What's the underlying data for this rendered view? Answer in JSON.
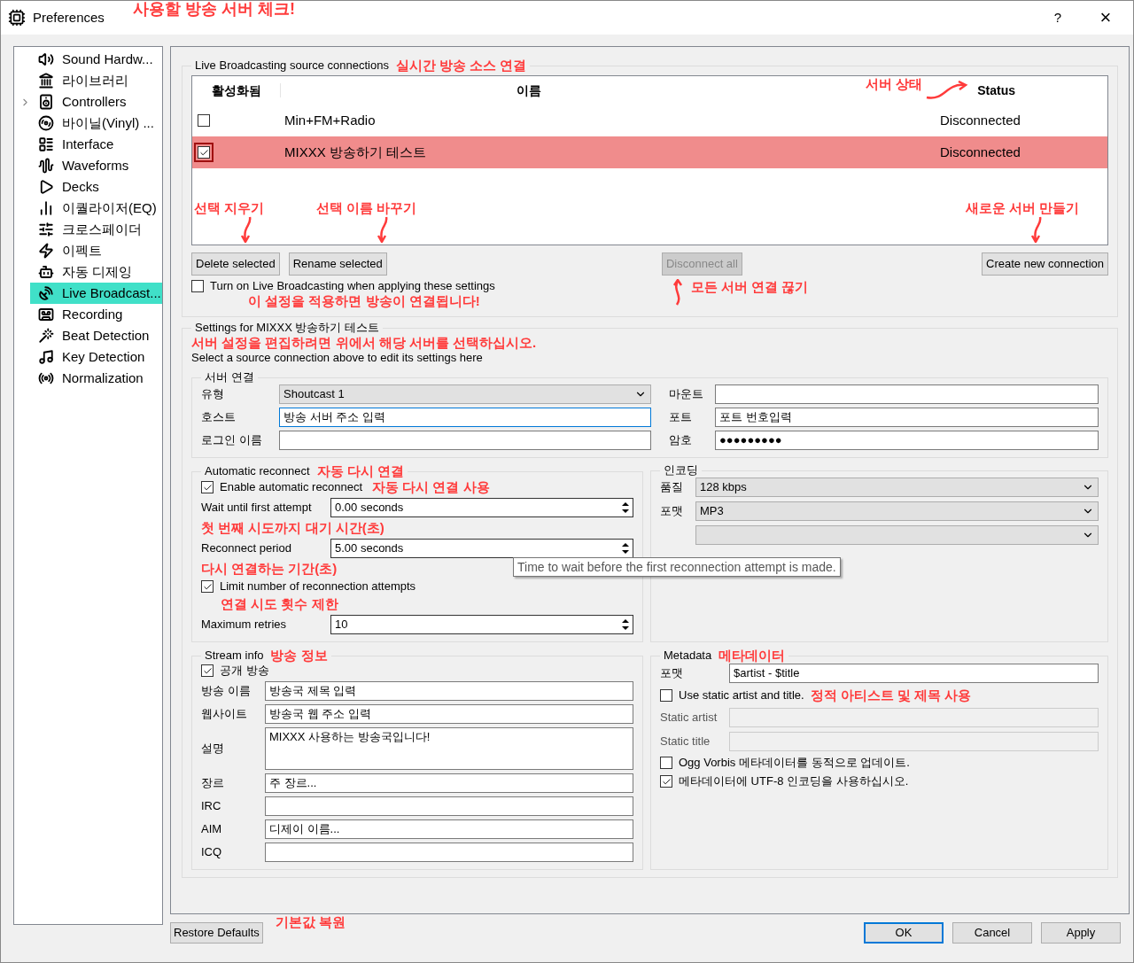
{
  "window": {
    "title": "Preferences",
    "help": "?",
    "close": "×",
    "note": "사용할 방송 서버 체크!"
  },
  "sidebar": {
    "items": [
      {
        "label": "Sound Hardw...",
        "expandable": false,
        "selected": false
      },
      {
        "label": "라이브러리",
        "expandable": false,
        "selected": false
      },
      {
        "label": "Controllers",
        "expandable": true,
        "selected": false
      },
      {
        "label": "바이닐(Vinyl) ...",
        "expandable": false,
        "selected": false
      },
      {
        "label": "Interface",
        "expandable": false,
        "selected": false
      },
      {
        "label": "Waveforms",
        "expandable": false,
        "selected": false
      },
      {
        "label": "Decks",
        "expandable": false,
        "selected": false
      },
      {
        "label": "이퀄라이저(EQ)",
        "expandable": false,
        "selected": false
      },
      {
        "label": "크로스페이더",
        "expandable": false,
        "selected": false
      },
      {
        "label": "이펙트",
        "expandable": false,
        "selected": false
      },
      {
        "label": "자동 디제잉",
        "expandable": false,
        "selected": false
      },
      {
        "label": "Live Broadcast...",
        "expandable": false,
        "selected": true
      },
      {
        "label": "Recording",
        "expandable": false,
        "selected": false
      },
      {
        "label": "Beat Detection",
        "expandable": false,
        "selected": false
      },
      {
        "label": "Key Detection",
        "expandable": false,
        "selected": false
      },
      {
        "label": "Normalization",
        "expandable": false,
        "selected": false
      }
    ]
  },
  "connections": {
    "title": "Live Broadcasting source connections",
    "note": "실시간 방송 소스 연결",
    "columns": [
      "활성화됨",
      "이름",
      "Status"
    ],
    "status_note": "서버 상태",
    "rows": [
      {
        "enabled": false,
        "name": "Min+FM+Radio",
        "status": "Disconnected",
        "selected": false
      },
      {
        "enabled": true,
        "name": "MIXXX 방송하기 테스트",
        "status": "Disconnected",
        "selected": true
      }
    ],
    "buttons": [
      {
        "label": "Delete selected",
        "disabled": false,
        "note": "선택 지우기"
      },
      {
        "label": "Rename selected",
        "disabled": false,
        "note": "선택 이름 바꾸기"
      },
      {
        "label": "Disconnect all",
        "disabled": true,
        "note": "모든 서버 연결 끊기"
      },
      {
        "label": "Create new connection",
        "disabled": false,
        "note": "새로운 서버 만들기"
      }
    ],
    "turn_on": {
      "label": "Turn on Live Broadcasting when applying these settings",
      "checked": false,
      "note": "이 설정을 적용하면 방송이 연결됩니다!"
    }
  },
  "settings": {
    "title": "Settings for MIXXX 방송하기 테스트",
    "note": "서버 설정을 편집하려면 위에서 해당 서버를 선택하십시오.",
    "hint": "Select a source connection above to edit its settings here",
    "server": {
      "title": "서버 연결",
      "left": [
        {
          "label": "유형",
          "value": "Shoutcast 1",
          "kind": "combo"
        },
        {
          "label": "호스트",
          "value": "방송 서버 주소 입력",
          "kind": "focused"
        },
        {
          "label": "로그인 이름",
          "kind": "text"
        }
      ],
      "right": [
        {
          "label": "마운트"
        },
        {
          "label": "포트",
          "value": "포트 번호입력"
        },
        {
          "label": "암호",
          "value": "●●●●●●●●●"
        }
      ]
    },
    "reconnect": {
      "title": "Automatic reconnect",
      "note": "자동 다시 연결",
      "enable": {
        "label": "Enable automatic reconnect",
        "checked": true,
        "note": "자동 다시 연결 사용"
      },
      "wait": {
        "label": "Wait until first attempt",
        "value": "0.00 seconds",
        "note": "첫 번째 시도까지 대기 시간(초)"
      },
      "period": {
        "label": "Reconnect period",
        "value": "5.00 seconds",
        "note": "다시 연결하는 기간(초)"
      },
      "limit": {
        "label": "Limit number of reconnection attempts",
        "checked": true,
        "note": "연결 시도 횟수 제한"
      },
      "retries": {
        "label": "Maximum retries",
        "value": "10"
      }
    },
    "tooltip": "Time to wait before the first reconnection attempt is made.",
    "encoding": {
      "title": "인코딩",
      "fields": [
        {
          "label": "품질",
          "value": "128 kbps"
        },
        {
          "label": "포맷",
          "value": "MP3"
        }
      ]
    },
    "stream": {
      "title": "Stream info",
      "note": "방송 정보",
      "public": {
        "label": "공개 방송",
        "checked": true
      },
      "fields": [
        {
          "label": "방송 이름",
          "value": "방송국 제목 입력",
          "kind": "line"
        },
        {
          "label": "웹사이트",
          "value": "방송국 웹 주소 입력",
          "kind": "line"
        },
        {
          "label": "설명",
          "value": "MIXXX 사용하는 방송국입니다!",
          "kind": "area"
        },
        {
          "label": "장르",
          "value": "주 장르...",
          "kind": "line"
        },
        {
          "label": "IRC",
          "kind": "line"
        },
        {
          "label": "AIM",
          "value": "디제이 이름...",
          "kind": "line"
        },
        {
          "label": "ICQ",
          "kind": "line"
        }
      ]
    },
    "metadata": {
      "title": "Metadata",
      "note": "메타데이터",
      "format": {
        "label": "포맷",
        "value": "$artist - $title"
      },
      "static": {
        "label": "Use static artist and title.",
        "checked": false,
        "note": "정적 아티스트 및 제목 사용"
      },
      "fields": [
        {
          "label": "Static artist",
          "disabled": true
        },
        {
          "label": "Static title",
          "disabled": true
        }
      ],
      "options": [
        {
          "label": "Ogg Vorbis 메타데이터를 동적으로 업데이트.",
          "checked": false
        },
        {
          "label": "메타데이터에 UTF-8 인코딩을 사용하십시오.",
          "checked": true
        }
      ]
    }
  },
  "footer": {
    "restore": "Restore Defaults",
    "note": "기본값 복원",
    "buttons": [
      {
        "label": "OK",
        "default": true
      },
      {
        "label": "Cancel",
        "default": false
      },
      {
        "label": "Apply",
        "default": false
      }
    ]
  }
}
